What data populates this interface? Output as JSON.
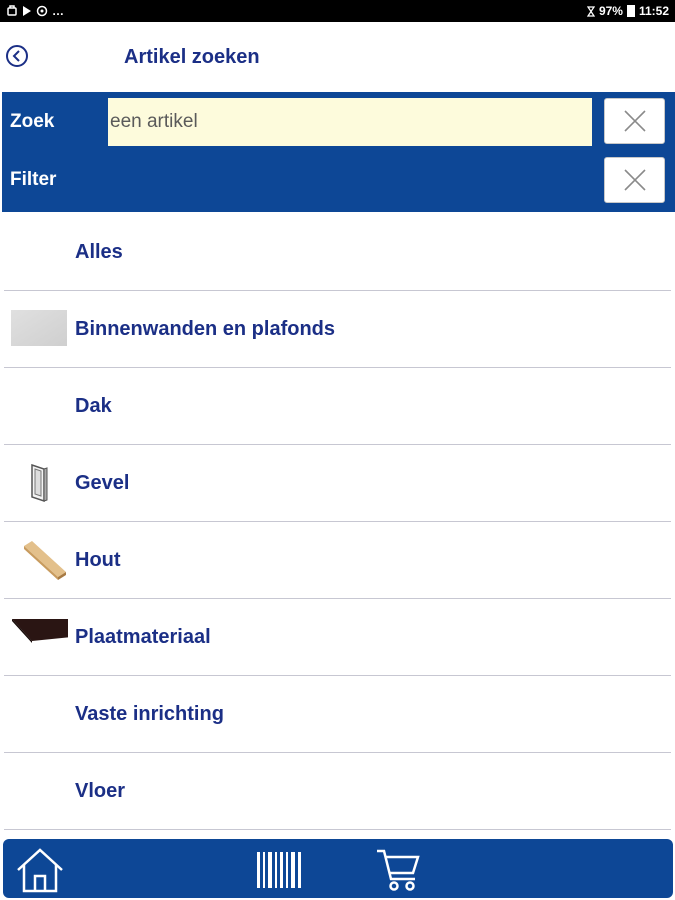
{
  "status_bar": {
    "left_text": "…",
    "battery": "97%",
    "time": "11:52"
  },
  "header": {
    "title": "Artikel zoeken"
  },
  "search": {
    "zoek_label": "Zoek",
    "placeholder": "een artikel",
    "filter_label": "Filter"
  },
  "categories": [
    {
      "label": "Alles",
      "icon": "none"
    },
    {
      "label": "Binnenwanden en plafonds",
      "icon": "gray-panel-icon"
    },
    {
      "label": "Dak",
      "icon": "none"
    },
    {
      "label": "Gevel",
      "icon": "window-frame-icon"
    },
    {
      "label": "Hout",
      "icon": "wood-beam-icon"
    },
    {
      "label": "Plaatmateriaal",
      "icon": "dark-plate-icon"
    },
    {
      "label": "Vaste inrichting",
      "icon": "none"
    },
    {
      "label": "Vloer",
      "icon": "none"
    }
  ],
  "bottom_nav": {
    "items": [
      "home-icon",
      "barcode-icon",
      "cart-icon"
    ]
  },
  "colors": {
    "primary": "#0d4796",
    "title_text": "#1b2f86",
    "search_bg": "#fdfbdc"
  }
}
